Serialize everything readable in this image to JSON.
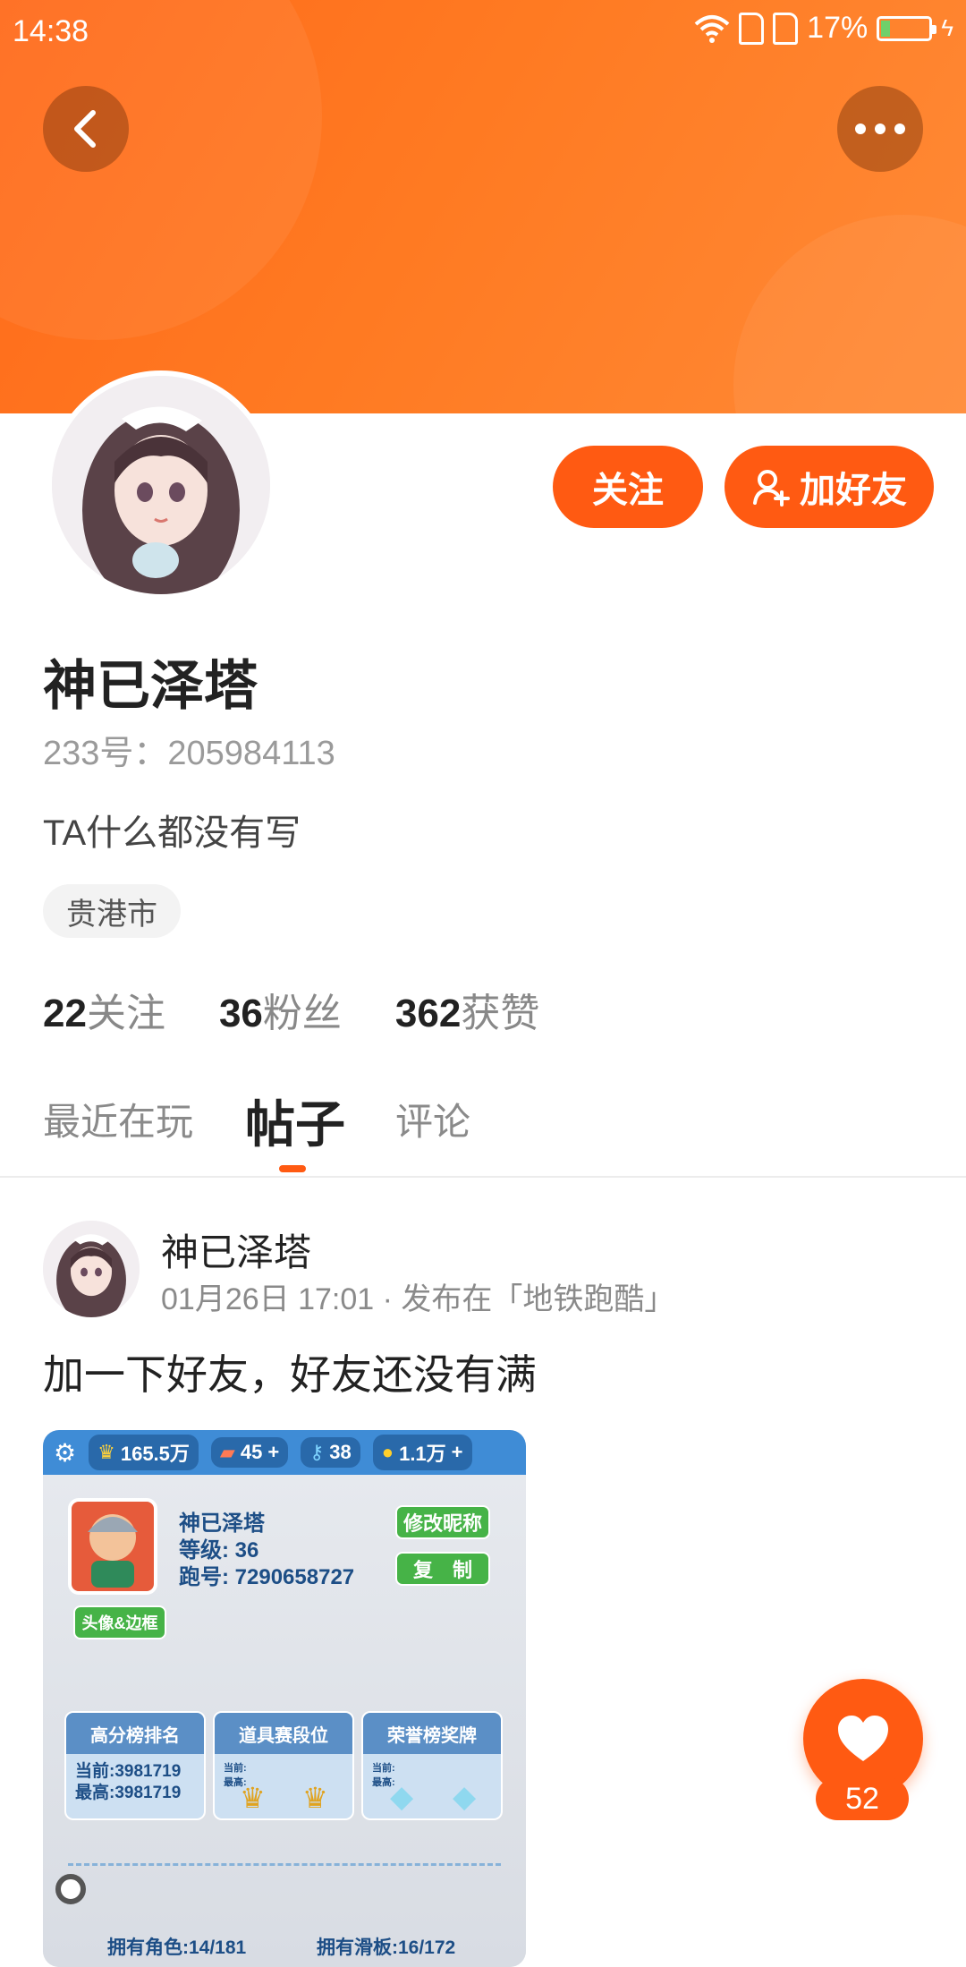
{
  "status_bar": {
    "time": "14:38",
    "battery": "17%"
  },
  "profile": {
    "name": "神已泽塔",
    "id_label": "233号：205984113",
    "bio": "TA什么都没有写",
    "location": "贵港市",
    "follow_label": "关注",
    "add_friend_label": "加好友",
    "stats": [
      {
        "value": "22",
        "label": "关注"
      },
      {
        "value": "36",
        "label": "粉丝"
      },
      {
        "value": "362",
        "label": "获赞"
      }
    ]
  },
  "tabs": [
    {
      "label": "最近在玩"
    },
    {
      "label": "帖子"
    },
    {
      "label": "评论"
    }
  ],
  "post": {
    "author": "神已泽塔",
    "meta": "01月26日 17:01 · 发布在「地铁跑酷」",
    "text": "加一下好友，好友还没有满",
    "image": {
      "top_bar": {
        "crowns": "165.5万",
        "boards": "45",
        "keys": "38",
        "coins": "1.1万"
      },
      "player_name": "神已泽塔",
      "level_label": "等级: 36",
      "run_id_label": "跑号: 7290658727",
      "rename_button": "修改昵称",
      "copy_button": "复　制",
      "avatar_frame_button": "头像&边框",
      "panels": [
        {
          "title": "高分榜排名",
          "line1": "当前:3981719",
          "line2": "最高:3981719"
        },
        {
          "title": "道具赛段位",
          "line1": "当前:",
          "line2": "最高:"
        },
        {
          "title": "荣誉榜奖牌",
          "line1": "当前:",
          "line2": "最高:"
        }
      ],
      "owned_roles": "拥有角色:14/181",
      "owned_boards": "拥有滑板:16/172"
    }
  },
  "like": {
    "count": "52"
  },
  "colors": {
    "accent": "#ff5a12",
    "header_start": "#ff6a1a",
    "header_end": "#ff8a36"
  }
}
